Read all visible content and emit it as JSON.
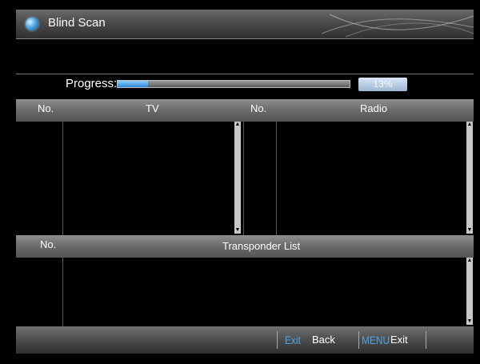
{
  "window": {
    "title": "Blind Scan"
  },
  "progress": {
    "label": "Progress:",
    "value": 0.13,
    "percent_text": "13%"
  },
  "channels_header": {
    "tv_no": "No.",
    "tv": "TV",
    "radio_no": "No.",
    "radio": "Radio"
  },
  "tv_list": [],
  "radio_list": [],
  "transponder_header": {
    "no": "No.",
    "title": "Transponder List"
  },
  "transponder_list": [],
  "footer": {
    "actions": [
      {
        "key": "Exit",
        "label": "Back"
      },
      {
        "key": "MENU",
        "label": "Exit"
      }
    ]
  },
  "colors": {
    "accent": "#4ba6e8",
    "progress_fill": "#2f86d6",
    "background": "#000000"
  }
}
